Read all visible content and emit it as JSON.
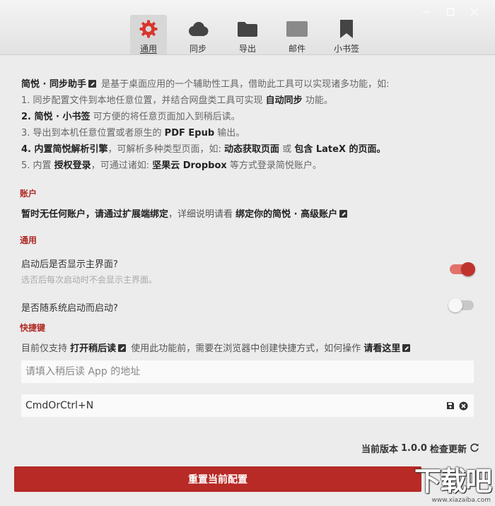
{
  "window": {
    "controls": [
      "minimize",
      "maximize",
      "close"
    ]
  },
  "tabs": [
    {
      "label": "通用",
      "icon": "gear-icon",
      "active": true
    },
    {
      "label": "同步",
      "icon": "cloud-icon",
      "active": false
    },
    {
      "label": "导出",
      "icon": "folder-icon",
      "active": false
    },
    {
      "label": "邮件",
      "icon": "mail-icon",
      "active": false
    },
    {
      "label": "小书签",
      "icon": "bookmark-icon",
      "active": false
    }
  ],
  "intro": {
    "l1_b": "简悦 · 同步助手",
    "l1_t": " 是基于桌面应用的一个辅助性工具，借助此工具可以实现诸多功能，如:",
    "l2_t": "1. 同步配置文件到本地任意位置，并结合网盘类工具可实现 ",
    "l2_b": "自动同步",
    "l2_t2": " 功能。",
    "l3_n": "2. ",
    "l3_b": "简悦 · 小书签",
    "l3_t": " 可方便的将任意页面加入到稍后读。",
    "l4_t": "3. 导出到本机任意位置或者原生的 ",
    "l4_b": "PDF Epub",
    "l4_t2": " 输出。",
    "l5_n": "4. ",
    "l5_b": "内置简悦解析引擎",
    "l5_t": "，可解析多种类型页面，如: ",
    "l5_b2": "动态获取页面",
    "l5_t2": " 或 ",
    "l5_b3": "包含 LateX 的页面。",
    "l6_t": "5. 内置 ",
    "l6_b": "授权登录",
    "l6_t2": "，可通过诸如: ",
    "l6_b2": "坚果云 Dropbox",
    "l6_t3": " 等方式登录简悦账户。"
  },
  "account": {
    "title": "账户",
    "text_b": "暂时无任何账户，请通过扩展端绑定",
    "text_t": "，详细说明请看 ",
    "link": "绑定你的简悦 · 高级账户"
  },
  "general": {
    "title": "通用",
    "opt1_label": "启动后是否显示主界面?",
    "opt1_desc": "选否后每次启动时不会显示主界面。",
    "opt1_on": true,
    "opt2_label": "是否随系统启动而启动?",
    "opt2_on": false
  },
  "shortcut": {
    "title": "快捷键",
    "t1": "目前仅支持 ",
    "b1": "打开稍后读",
    "t2": " 使用此功能前，需要在浏览器中创建快捷方式，如何操作 ",
    "b2": "请看这里",
    "app_placeholder": "请填入稍后读 App 的地址",
    "hotkey_value": "CmdOrCtrl+N"
  },
  "footer": {
    "version_label": "当前版本",
    "version": "1.0.0",
    "check_update": "检查更新",
    "reset_button": "重置当前配置"
  },
  "colors": {
    "accent": "#b72a26",
    "section_title": "#b02a25"
  },
  "watermark": {
    "main": "下载吧",
    "sub": "www.xiazaiba.com"
  }
}
